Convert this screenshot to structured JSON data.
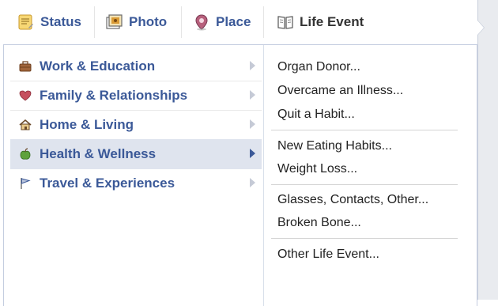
{
  "tabs": [
    {
      "label": "Status",
      "icon": "status-note-icon"
    },
    {
      "label": "Photo",
      "icon": "photo-icon"
    },
    {
      "label": "Place",
      "icon": "place-pin-icon"
    },
    {
      "label": "Life Event",
      "icon": "book-icon"
    }
  ],
  "categories": [
    {
      "label": "Work & Education",
      "icon": "briefcase-icon",
      "active": false
    },
    {
      "label": "Family & Relationships",
      "icon": "heart-icon",
      "active": false
    },
    {
      "label": "Home & Living",
      "icon": "house-icon",
      "active": false
    },
    {
      "label": "Health & Wellness",
      "icon": "apple-icon",
      "active": true
    },
    {
      "label": "Travel & Experiences",
      "icon": "flag-icon",
      "active": false
    }
  ],
  "subitems": {
    "group1": [
      "Organ Donor...",
      "Overcame an Illness...",
      "Quit a Habit..."
    ],
    "group2": [
      "New Eating Habits...",
      "Weight Loss..."
    ],
    "group3": [
      "Glasses, Contacts, Other...",
      "Broken Bone..."
    ],
    "group4": [
      "Other Life Event..."
    ]
  },
  "colors": {
    "link": "#3b5998",
    "active_bg": "#dfe4ee",
    "text": "#222222"
  }
}
